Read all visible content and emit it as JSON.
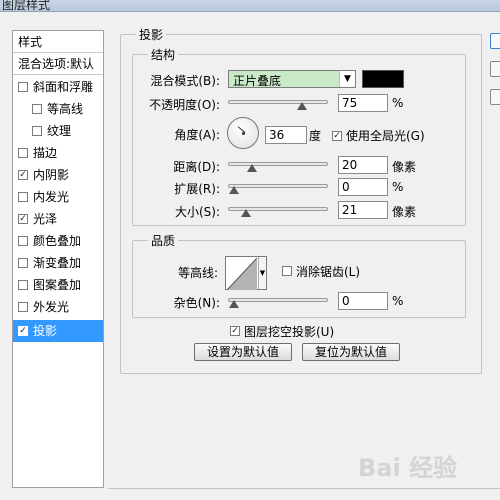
{
  "window": {
    "title": "图层样式"
  },
  "left_panel": {
    "header": "样式",
    "blend_options": "混合选项:默认",
    "items": [
      {
        "label": "斜面和浮雕",
        "checked": false
      },
      {
        "label": "等高线",
        "checked": false
      },
      {
        "label": "纹理",
        "checked": false
      },
      {
        "label": "描边",
        "checked": false
      },
      {
        "label": "内阴影",
        "checked": true
      },
      {
        "label": "内发光",
        "checked": false
      },
      {
        "label": "光泽",
        "checked": true
      },
      {
        "label": "颜色叠加",
        "checked": false
      },
      {
        "label": "渐变叠加",
        "checked": false
      },
      {
        "label": "图案叠加",
        "checked": false
      },
      {
        "label": "外发光",
        "checked": false
      },
      {
        "label": "投影",
        "checked": true,
        "selected": true
      }
    ],
    "check_mark": "✓"
  },
  "drop_shadow": {
    "section_title": "投影",
    "structure": {
      "title": "结构",
      "blend_mode_label": "混合模式(B):",
      "blend_mode_value": "正片叠底",
      "shadow_color": "#000000",
      "opacity_label": "不透明度(O):",
      "opacity_value": "75",
      "opacity_unit": "%",
      "angle_label": "角度(A):",
      "angle_value": "36",
      "angle_unit": "度",
      "global_light_label": "使用全局光(G)",
      "global_light_checked": true,
      "distance_label": "距离(D):",
      "distance_value": "20",
      "distance_unit": "像素",
      "spread_label": "扩展(R):",
      "spread_value": "0",
      "spread_unit": "%",
      "size_label": "大小(S):",
      "size_value": "21",
      "size_unit": "像素"
    },
    "quality": {
      "title": "品质",
      "contour_label": "等高线:",
      "anti_alias_label": "消除锯齿(L)",
      "anti_alias_checked": false,
      "noise_label": "杂色(N):",
      "noise_value": "0",
      "noise_unit": "%"
    },
    "knockout_label": "图层挖空投影(U)",
    "knockout_checked": true,
    "set_default_button": "设置为默认值",
    "reset_default_button": "复位为默认值"
  },
  "sliders": {
    "opacity_fraction": 0.75,
    "distance_fraction": 0.2,
    "spread_fraction": 0.0,
    "size_fraction": 0.13,
    "noise_fraction": 0.0
  },
  "colors": {
    "selection_blue": "#3399ff",
    "blend_select_bg": "#c9e9c9"
  },
  "watermark": "Bai 经验"
}
